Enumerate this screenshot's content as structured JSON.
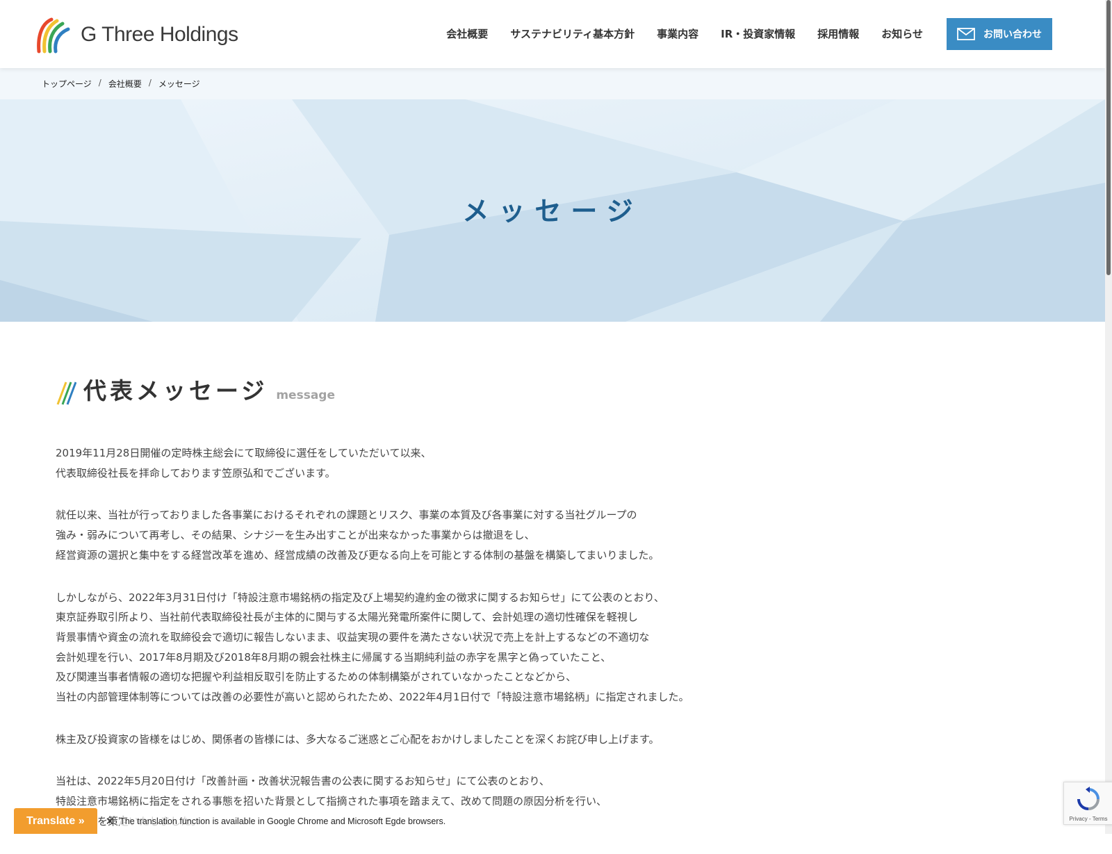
{
  "header": {
    "logo_text": "G Three Holdings",
    "nav": [
      "会社概要",
      "サステナビリティ基本方針",
      "事業内容",
      "IR・投資家情報",
      "採用情報",
      "お知らせ"
    ],
    "contact_label": "お問い合わせ"
  },
  "breadcrumb": [
    "トップページ",
    "会社概要",
    "メッセージ"
  ],
  "breadcrumb_sep": "/",
  "hero": {
    "title": "メッセージ"
  },
  "section": {
    "title": "代表メッセージ",
    "subtitle": "message"
  },
  "paragraphs": [
    [
      "2019年11月28日開催の定時株主総会にて取締役に選任をしていただいて以来、",
      "代表取締役社長を拝命しております笠原弘和でございます。"
    ],
    [
      "就任以来、当社が行っておりました各事業におけるそれぞれの課題とリスク、事業の本質及び各事業に対する当社グループの",
      "強み・弱みについて再考し、その結果、シナジーを生み出すことが出来なかった事業からは撤退をし、",
      "経営資源の選択と集中をする経営改革を進め、経営成績の改善及び更なる向上を可能とする体制の基盤を構築してまいりました。"
    ],
    [
      "しかしながら、2022年3月31日付け「特設注意市場銘柄の指定及び上場契約違約金の徴求に関するお知らせ」にて公表のとおり、",
      "東京証券取引所より、当社前代表取締役社長が主体的に関与する太陽光発電所案件に関して、会計処理の適切性確保を軽視し",
      "背景事情や資金の流れを取締役会で適切に報告しないまま、収益実現の要件を満たさない状況で売上を計上するなどの不適切な",
      "会計処理を行い、2017年8月期及び2018年8月期の親会社株主に帰属する当期純利益の赤字を黒字と偽っていたこと、",
      "及び関連当事者情報の適切な把握や利益相反取引を防止するための体制構築がされていなかったことなどから、",
      "当社の内部管理体制等については改善の必要性が高いと認められたため、2022年4月1日付で「特設注意市場銘柄」に指定されました。"
    ],
    [
      "株主及び投資家の皆様をはじめ、関係者の皆様には、多大なるご迷惑とご心配をおかけしましたことを深くお詫び申し上げます。"
    ],
    [
      "当社は、2022年5月20日付け「改善計画・改善状況報告書の公表に関するお知らせ」にて公表のとおり、",
      "特設注意市場銘柄に指定をされる事態を招いた背景として指摘された事項を踏まえて、改めて問題の原因分析を行い、",
      "改善計画を策定いたしました。"
    ]
  ],
  "translate": {
    "button": "Translate »",
    "close": "✕",
    "note": "The translation function is available in Google Chrome and Microsoft Egde browsers."
  },
  "recaptcha": {
    "text": "Privacy - Terms"
  },
  "colors": {
    "accent": "#3a8cc4",
    "hero_title": "#1e5e8e",
    "translate": "#f29d2e"
  },
  "icons": {
    "logo": "rainbow-arcs-logo-icon",
    "contact": "mail-icon",
    "section": "slash-icon",
    "recaptcha": "recaptcha-icon"
  }
}
